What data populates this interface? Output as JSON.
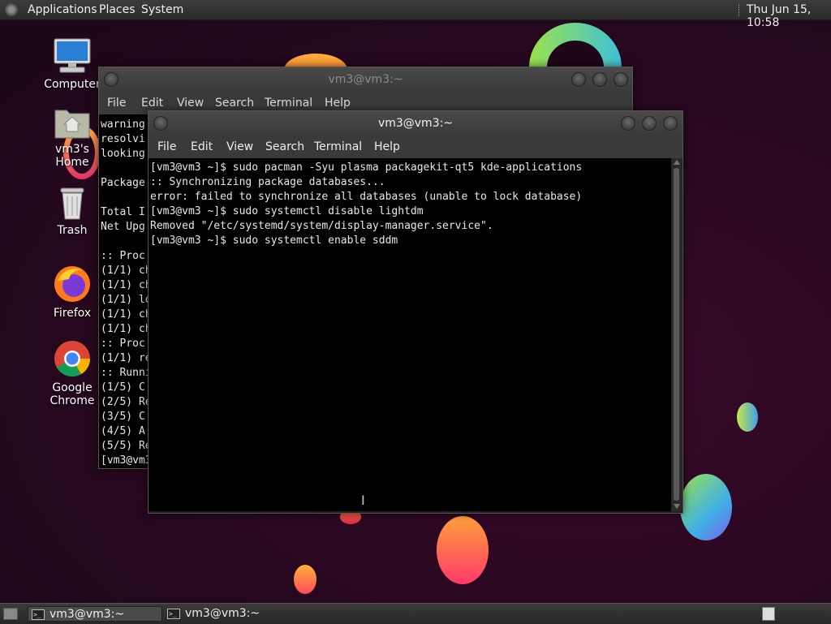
{
  "top_panel": {
    "menus": [
      "Applications",
      "Places",
      "System"
    ],
    "clock": "Thu Jun 15, 10:58"
  },
  "desktop_icons": [
    {
      "label": "Computer",
      "icon": "computer-icon"
    },
    {
      "label": "vm3's Home",
      "icon": "home-folder-icon"
    },
    {
      "label": "Trash",
      "icon": "trash-icon"
    },
    {
      "label": "Firefox",
      "icon": "firefox-icon"
    },
    {
      "label": "Google Chrome",
      "icon": "chrome-icon"
    }
  ],
  "back_window": {
    "title": "vm3@vm3:~",
    "menu": [
      "File",
      "Edit",
      "View",
      "Search",
      "Terminal",
      "Help"
    ],
    "lines": [
      "warning",
      "resolvi",
      "looking",
      "",
      "Package",
      "",
      "Total I",
      "Net Upg",
      "",
      ":: Proc",
      "(1/1) ch",
      "(1/1) ch",
      "(1/1) lo",
      "(1/1) ch",
      "(1/1) ch",
      ":: Proc",
      "(1/1) re",
      ":: Runni",
      "(1/5) C",
      "(2/5) Re",
      "(3/5) C",
      "(4/5) A",
      "(5/5) Re",
      "[vm3@vm3"
    ]
  },
  "front_window": {
    "title": "vm3@vm3:~",
    "menu": [
      "File",
      "Edit",
      "View",
      "Search",
      "Terminal",
      "Help"
    ],
    "lines": [
      "[vm3@vm3 ~]$ sudo pacman -Syu plasma packagekit-qt5 kde-applications",
      ":: Synchronizing package databases...",
      "error: failed to synchronize all databases (unable to lock database)",
      "[vm3@vm3 ~]$ sudo systemctl disable lightdm",
      "Removed \"/etc/systemd/system/display-manager.service\".",
      "[vm3@vm3 ~]$ sudo systemctl enable sddm"
    ]
  },
  "taskbar": {
    "tasks": [
      "vm3@vm3:~",
      "vm3@vm3:~"
    ]
  },
  "colors": {
    "panel": "#2b2b2b",
    "terminal_bg": "#000000",
    "terminal_fg": "#e8e8e8"
  }
}
